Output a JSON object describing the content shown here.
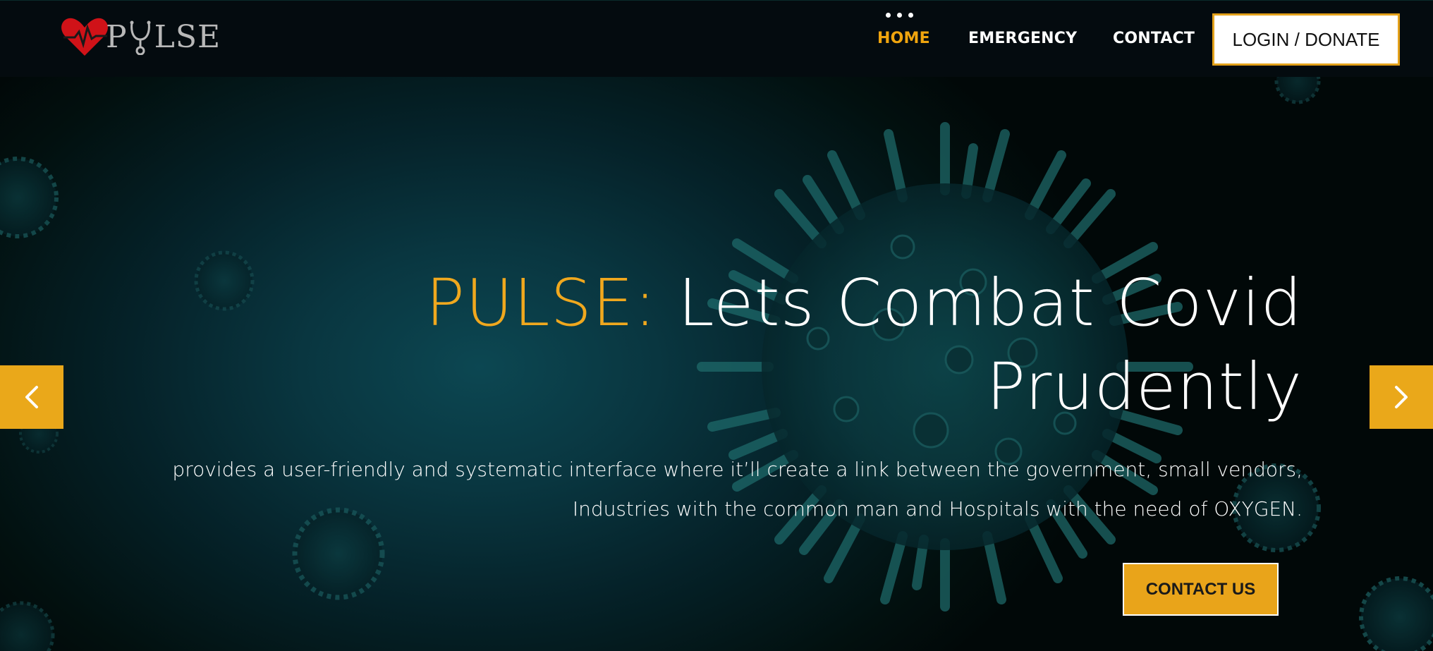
{
  "brand": {
    "logo_text": "P LSE",
    "logo_icon": "heart-pulse-stethoscope-icon"
  },
  "nav": {
    "items": [
      {
        "label": "HOME",
        "active": true
      },
      {
        "label": "EMERGENCY",
        "active": false
      },
      {
        "label": "CONTACT",
        "active": false
      }
    ],
    "login_label": "LOGIN / DONATE",
    "menu_icon": "dots-icon"
  },
  "hero": {
    "headline_brand": "PULSE:",
    "headline_rest": " Lets Combat Covid Prudently",
    "subtext_line1": "provides a user-friendly and systematic interface where it’ll create a link between the government, small vendors,",
    "subtext_line2": "Industries with the common man and Hospitals with the need of OXYGEN.",
    "cta_label": "CONTACT US",
    "prev_icon": "chevron-left-icon",
    "next_icon": "chevron-right-icon"
  },
  "colors": {
    "accent": "#f0a81e",
    "nav_bg": "#040b0f",
    "hero_bg": "#0a3a44",
    "text": "#ffffff"
  }
}
